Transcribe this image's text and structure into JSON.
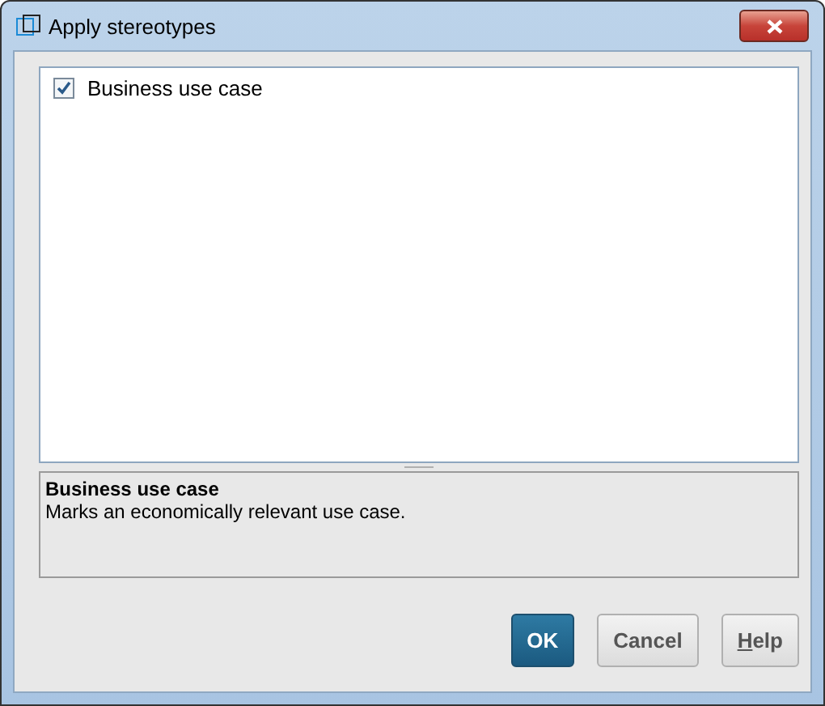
{
  "window": {
    "title": "Apply stereotypes"
  },
  "stereotypes": [
    {
      "label": "Business use case",
      "checked": true
    }
  ],
  "description": {
    "title": "Business use case",
    "text": "Marks an economically relevant use case."
  },
  "buttons": [
    {
      "kind": "default",
      "label": "OK"
    },
    {
      "kind": "normal",
      "label": "Cancel"
    },
    {
      "kind": "mnemonic",
      "mnemonic": "H",
      "label": "elp"
    }
  ]
}
